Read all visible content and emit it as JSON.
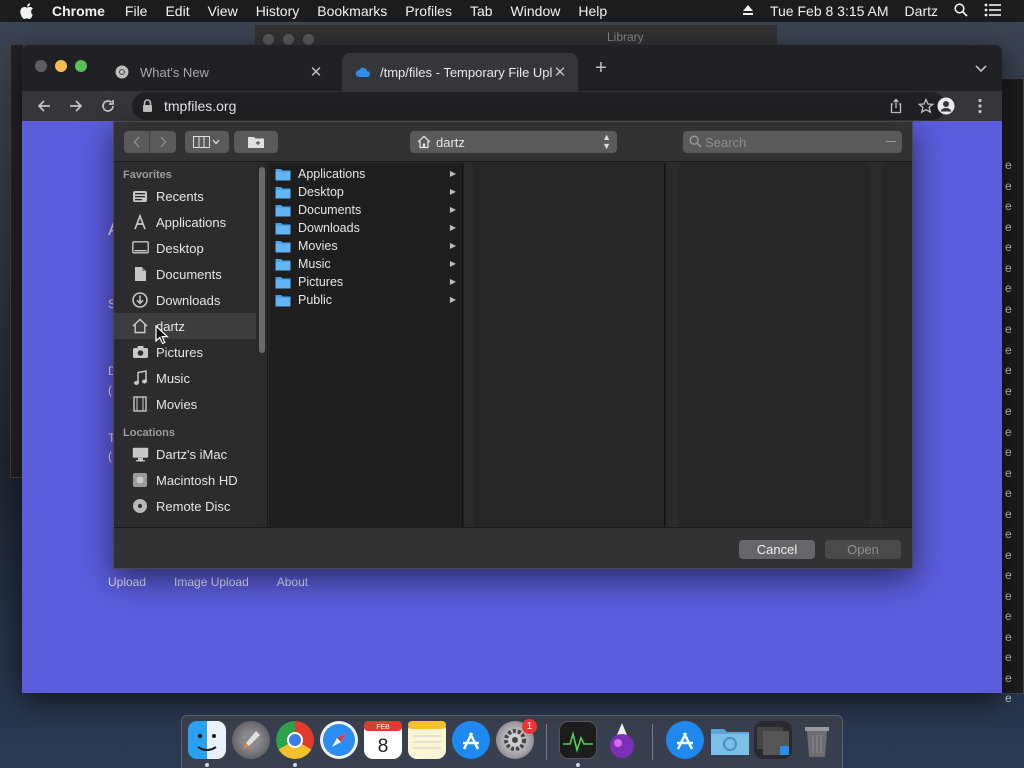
{
  "menubar": {
    "app_name": "Chrome",
    "menus": [
      "File",
      "Edit",
      "View",
      "History",
      "Bookmarks",
      "Profiles",
      "Tab",
      "Window",
      "Help"
    ],
    "datetime": "Tue Feb 8  3:15 AM",
    "user": "Dartz"
  },
  "background": {
    "library_title": "Library",
    "right_window_letters": [
      "e",
      "e",
      "e",
      "e",
      "e",
      "e",
      "e",
      "e",
      "e",
      "e",
      "e",
      "e",
      "e",
      "e",
      "e",
      "e",
      "e",
      "e",
      "e",
      "e",
      "e",
      "e",
      "e",
      "e",
      "e",
      "e",
      "e"
    ]
  },
  "chrome": {
    "tabs": [
      {
        "title": "What's New"
      },
      {
        "title": "/tmp/files - Temporary File Upload"
      }
    ],
    "url": "tmpfiles.org"
  },
  "page": {
    "nav": [
      "Upload",
      "Image Upload",
      "About"
    ],
    "fragments": [
      "A",
      "S",
      "D",
      "(",
      "T",
      "("
    ]
  },
  "dialog": {
    "location": "dartz",
    "search_placeholder": "Search",
    "sidebar": {
      "favorites_label": "Favorites",
      "favorites": [
        {
          "label": "Recents",
          "icon": "clock-icon"
        },
        {
          "label": "Applications",
          "icon": "applications-icon"
        },
        {
          "label": "Desktop",
          "icon": "desktop-icon"
        },
        {
          "label": "Documents",
          "icon": "documents-icon"
        },
        {
          "label": "Downloads",
          "icon": "downloads-icon"
        },
        {
          "label": "dartz",
          "icon": "home-icon"
        },
        {
          "label": "Pictures",
          "icon": "camera-icon"
        },
        {
          "label": "Music",
          "icon": "music-note-icon"
        },
        {
          "label": "Movies",
          "icon": "film-icon"
        }
      ],
      "locations_label": "Locations",
      "locations": [
        {
          "label": "Dartz's iMac",
          "icon": "computer-icon"
        },
        {
          "label": "Macintosh HD",
          "icon": "disk-icon"
        },
        {
          "label": "Remote Disc",
          "icon": "disc-icon"
        }
      ]
    },
    "files": [
      "Applications",
      "Desktop",
      "Documents",
      "Downloads",
      "Movies",
      "Music",
      "Pictures",
      "Public"
    ],
    "cancel_label": "Cancel",
    "open_label": "Open"
  },
  "dock": {
    "apps": [
      "Finder",
      "Launchpad",
      "Google Chrome",
      "Safari",
      "Calendar",
      "Notes",
      "App Store",
      "System Preferences",
      "Activity Monitor",
      "Inkscape",
      "App Store",
      "Downloads",
      "Photo Slideshow",
      "Trash"
    ],
    "calendar_month": "FEB",
    "calendar_day": "8",
    "prefs_badge": "1"
  }
}
